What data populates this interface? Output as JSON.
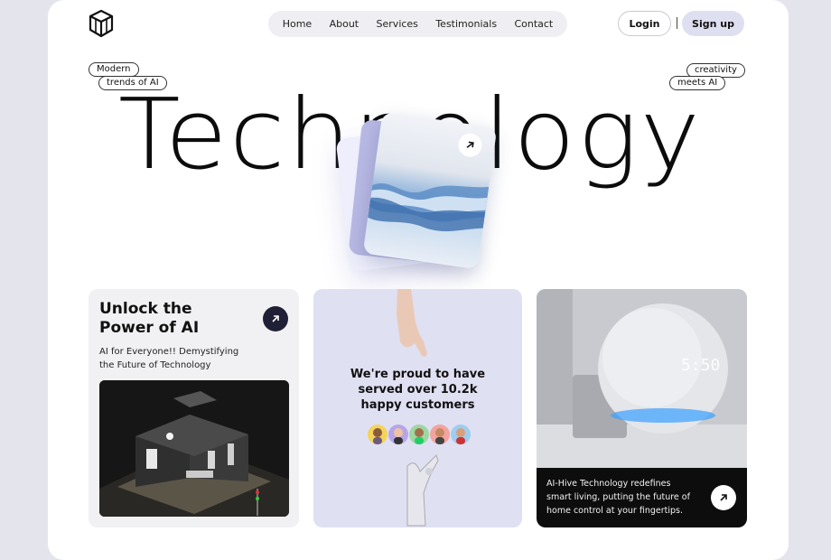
{
  "nav": {
    "items": [
      "Home",
      "About",
      "Services",
      "Testimonials",
      "Contact"
    ],
    "login": "Login",
    "signup": "Sign up"
  },
  "pills": {
    "left_top": "Modern",
    "left_bottom": "trends of AI",
    "right_top": "creativity",
    "right_bottom": "meets AI"
  },
  "hero": {
    "word": "Technology"
  },
  "cards": {
    "unlock": {
      "title": "Unlock the Power of AI",
      "subtitle": "AI for Everyone!! Demystifying the Future of Technology"
    },
    "customers": {
      "text": "We're proud to have served over 10.2k happy customers"
    },
    "smart_home": {
      "text": "AI-Hive Technology redefines smart living, putting the future of home control at your fingertips.",
      "clock_display": "5:50"
    }
  },
  "colors": {
    "background": "#e4e5ec",
    "accent": "#dfdff2",
    "dark": "#1f1f36"
  }
}
